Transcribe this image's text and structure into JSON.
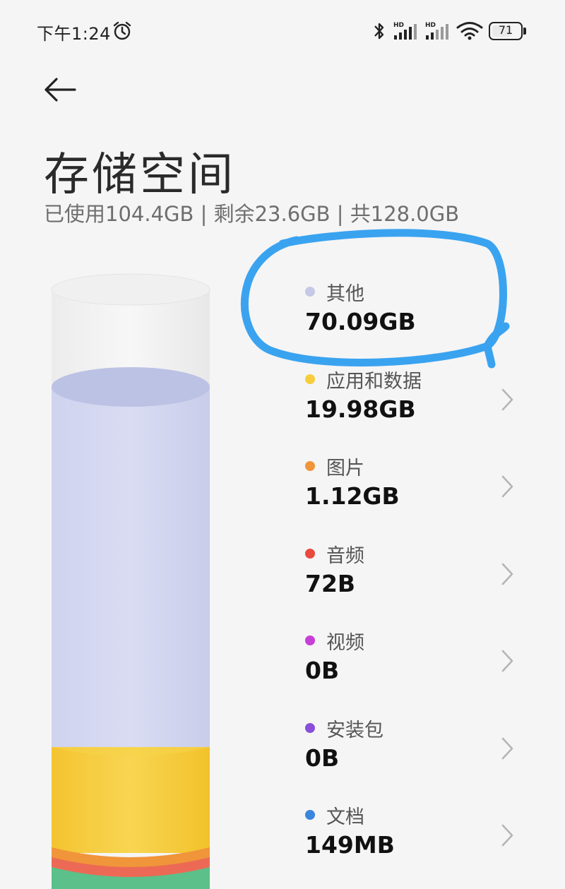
{
  "status_bar": {
    "time": "下午1:24",
    "icons": [
      "alarm-icon",
      "bluetooth-icon",
      "hd-signal-icon",
      "hd-signal-icon",
      "wifi-icon",
      "battery-icon"
    ],
    "battery": "71",
    "battery_level": 0.71
  },
  "header": {
    "back_icon": "arrow-left-icon",
    "title": "存储空间",
    "summary": "已使用104.4GB | 剩余23.6GB | 共128.0GB"
  },
  "categories": [
    {
      "label": "其他",
      "value": "70.09GB",
      "color": "#c5c9e6",
      "has_chevron": false
    },
    {
      "label": "应用和数据",
      "value": "19.98GB",
      "color": "#f7cd3d",
      "has_chevron": true
    },
    {
      "label": "图片",
      "value": "1.12GB",
      "color": "#f0953a",
      "has_chevron": true
    },
    {
      "label": "音频",
      "value": "72B",
      "color": "#e84a3e",
      "has_chevron": true
    },
    {
      "label": "视频",
      "value": "0B",
      "color": "#c63fd6",
      "has_chevron": true
    },
    {
      "label": "安装包",
      "value": "0B",
      "color": "#8a4fd9",
      "has_chevron": true
    },
    {
      "label": "文档",
      "value": "149MB",
      "color": "#3a86dc",
      "has_chevron": true
    }
  ],
  "annotation": {
    "color": "#3aa3f0",
    "shape": "hand-drawn-circle"
  }
}
